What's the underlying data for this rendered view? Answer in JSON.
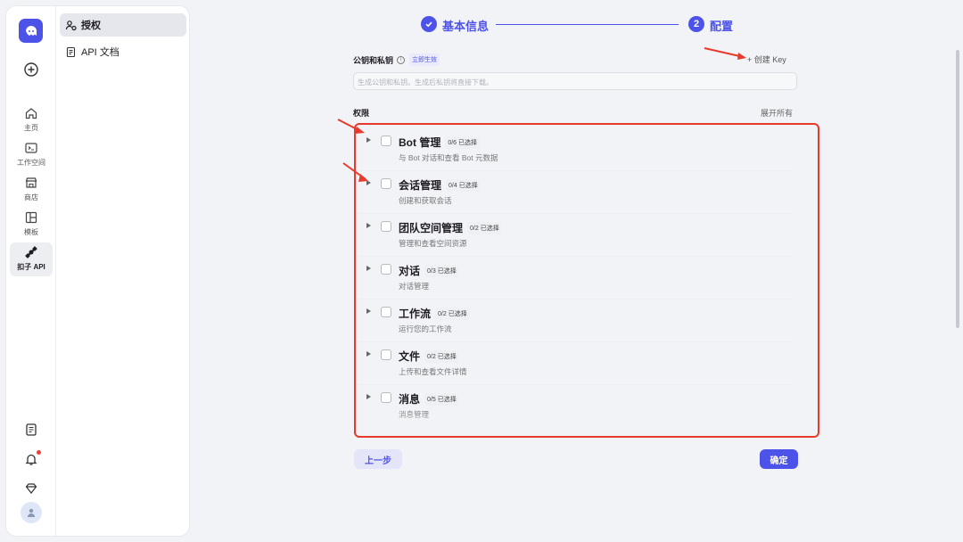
{
  "sidebar": {
    "items": [
      {
        "label": "主页",
        "icon": "home-icon"
      },
      {
        "label": "工作空间",
        "icon": "terminal-icon"
      },
      {
        "label": "商店",
        "icon": "store-icon"
      },
      {
        "label": "模板",
        "icon": "template-icon"
      },
      {
        "label": "扣子 API",
        "icon": "api-icon",
        "active": true
      }
    ],
    "bottom_icons": [
      "docs-icon",
      "bell-icon",
      "diamond-icon",
      "avatar-icon"
    ],
    "accent": "#4d53e8"
  },
  "subnav": {
    "items": [
      {
        "label": "授权",
        "icon": "auth-icon",
        "active": true
      },
      {
        "label": "API 文档",
        "icon": "document-icon"
      }
    ]
  },
  "stepper": {
    "step1": {
      "label": "基本信息",
      "status": "done"
    },
    "step2": {
      "label": "配置",
      "number": "2",
      "status": "current"
    }
  },
  "key": {
    "title": "公钥和私钥",
    "info": "i",
    "tag": "立即生效",
    "create_label": "+ 创建 Key",
    "placeholder": "生成公钥和私钥。生成后私钥将直接下载。"
  },
  "permissions": {
    "title": "权限",
    "expand_all": "展开所有",
    "items": [
      {
        "name": "Bot 管理",
        "count": "0/6 已选择",
        "desc": "与 Bot 对话和查看 Bot 元数据"
      },
      {
        "name": "会话管理",
        "count": "0/4 已选择",
        "desc": "创建和获取会话"
      },
      {
        "name": "团队空间管理",
        "count": "0/2 已选择",
        "desc": "管理和查看空间资源"
      },
      {
        "name": "对话",
        "count": "0/3 已选择",
        "desc": "对话管理"
      },
      {
        "name": "工作流",
        "count": "0/2 已选择",
        "desc": "运行您的工作流"
      },
      {
        "name": "文件",
        "count": "0/2 已选择",
        "desc": "上传和查看文件详情"
      },
      {
        "name": "消息",
        "count": "0/5 已选择",
        "desc": "消息管理"
      }
    ]
  },
  "buttons": {
    "prev": "上一步",
    "ok": "确定"
  },
  "annotation_color": "#e83a2c"
}
